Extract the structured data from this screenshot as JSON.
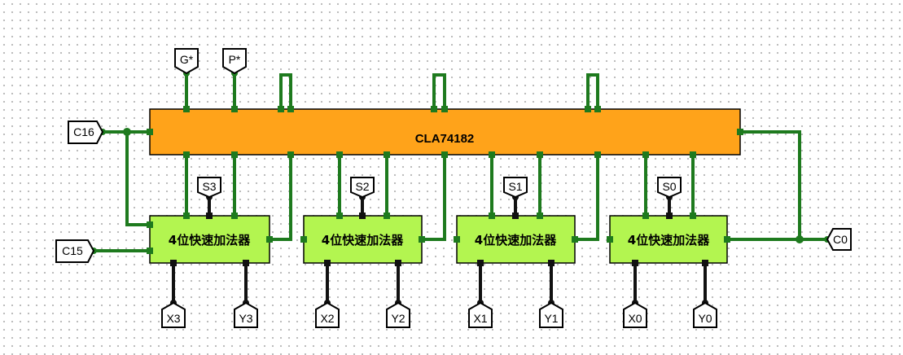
{
  "main_chip": {
    "label": "CLA74182"
  },
  "adders": [
    {
      "label": "4位快速加法器",
      "s": "S3",
      "x": "X3",
      "y": "Y3"
    },
    {
      "label": "4位快速加法器",
      "s": "S2",
      "x": "X2",
      "y": "Y2"
    },
    {
      "label": "4位快速加法器",
      "s": "S1",
      "x": "X1",
      "y": "Y1"
    },
    {
      "label": "4位快速加法器",
      "s": "S0",
      "x": "X0",
      "y": "Y0"
    }
  ],
  "pins": {
    "g_star": "G*",
    "p_star": "P*",
    "c16": "C16",
    "c15": "C15",
    "c0": "C0"
  },
  "colors": {
    "wire": "#1e7a1e",
    "bus": "#111111",
    "main_chip": "#ffa31a",
    "adder": "#b3f550"
  }
}
